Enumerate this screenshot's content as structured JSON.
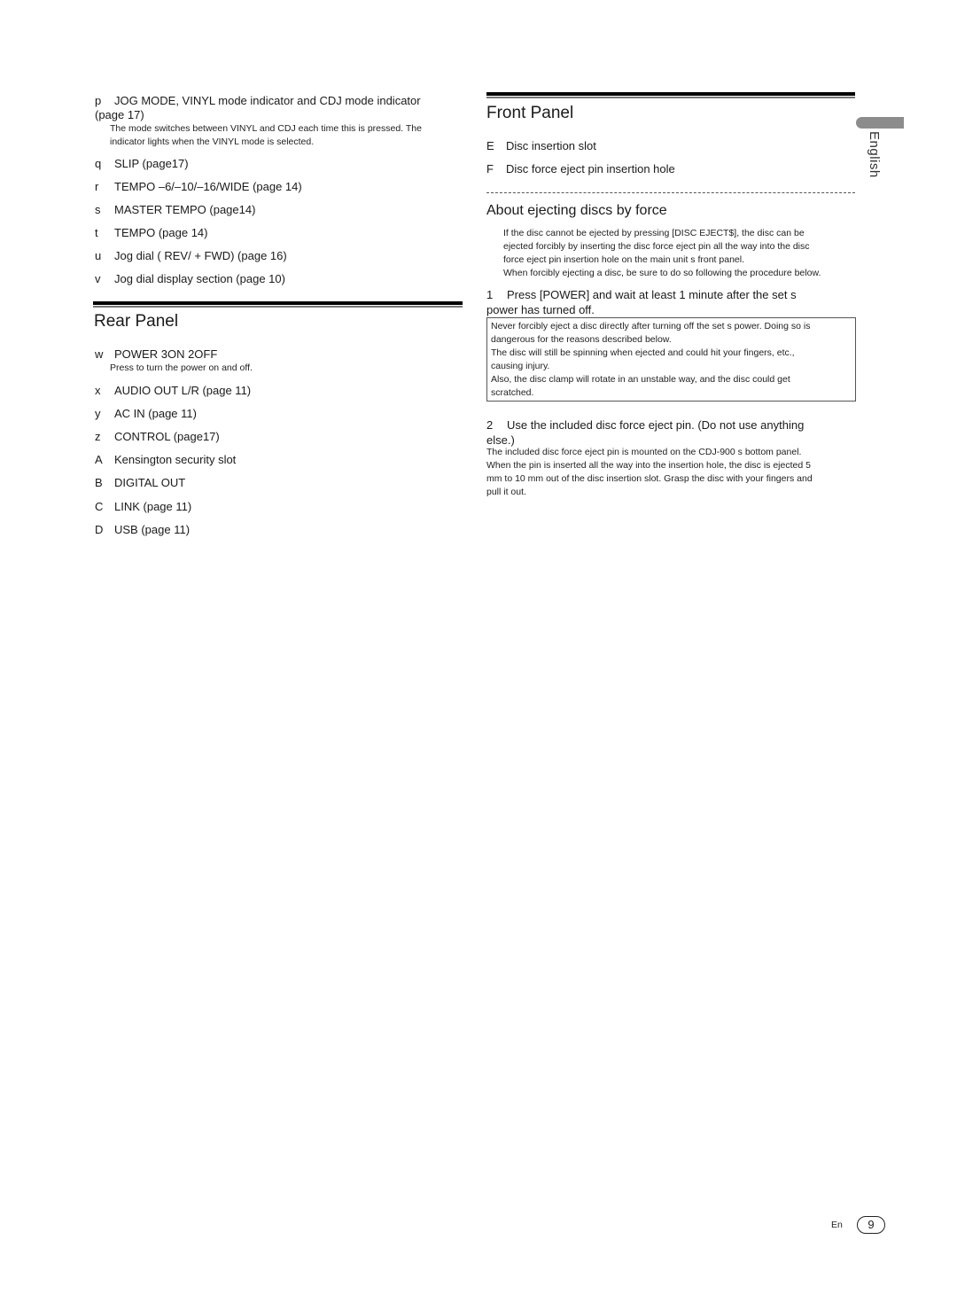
{
  "left_column": {
    "top_items": [
      {
        "marker": "p",
        "label": "JOG MODE, VINYL mode indicator and CDJ mode indicator",
        "label_cont": "(page 17)",
        "description": [
          "The mode switches between VINYL and CDJ each time this is pressed. The",
          "indicator lights when the VINYL mode is selected."
        ]
      },
      {
        "marker": "q",
        "label": "SLIP (page17)"
      },
      {
        "marker": "r",
        "label": "TEMPO –6/–10/–16/WIDE (page  14)"
      },
      {
        "marker": "s",
        "label": "MASTER TEMPO (page14)"
      },
      {
        "marker": "t",
        "label": "TEMPO (page 14)"
      },
      {
        "marker": "u",
        "label": "Jog dial (  REV/ + FWD) (page 16)"
      },
      {
        "marker": "v",
        "label": "Jog dial display section (page   10)"
      }
    ],
    "rear_panel": {
      "heading": "Rear Panel",
      "items": [
        {
          "marker": "w",
          "label": "POWER 3ON  2OFF",
          "description": "Press to turn the power on and off."
        },
        {
          "marker": "x",
          "label": "AUDIO OUT L/R (page 11)"
        },
        {
          "marker": "y",
          "label": "AC IN (page 11)"
        },
        {
          "marker": "z",
          "label": "CONTROL (page17)"
        },
        {
          "marker": "A",
          "label": "Kensington security slot"
        },
        {
          "marker": "B",
          "label": "DIGITAL OUT"
        },
        {
          "marker": "C",
          "label": "LINK (page 11)"
        },
        {
          "marker": "D",
          "label": "USB (page 11)"
        }
      ]
    }
  },
  "right_column": {
    "front_panel": {
      "heading": "Front Panel",
      "items": [
        {
          "marker": "E",
          "label": "Disc insertion slot"
        },
        {
          "marker": "F",
          "label": "Disc force eject pin insertion hole"
        }
      ]
    },
    "ejecting": {
      "heading": "About ejecting discs by force",
      "intro": [
        "If the disc cannot be ejected by pressing [DISC EJECT$], the disc can be",
        "ejected forcibly by inserting the disc force eject pin all the way into the disc",
        "force eject pin insertion hole on the main unit s front panel.",
        "When forcibly ejecting a disc, be sure to do so following the procedure below."
      ],
      "step1": {
        "number": "1",
        "text": "Press [POWER] and wait at least 1 minute after the set s",
        "text_cont": "power has turned off."
      },
      "warning": [
        "Never forcibly eject a disc directly after turning off the set s power. Doing so is",
        "dangerous for the reasons described below.",
        "The disc will still be spinning when ejected and could hit your fingers, etc.,",
        "causing injury.",
        "Also, the disc clamp will rotate in an unstable way, and the disc could get",
        "scratched."
      ],
      "step2": {
        "number": "2",
        "text": "Use the included disc force eject pin. (Do not use anything",
        "text_cont": "else.)"
      },
      "step2_body": [
        "The included disc force eject pin is mounted on the CDJ-900 s bottom panel.",
        "When the pin is inserted all the way into the insertion hole, the disc is ejected 5",
        "mm to 10 mm out of the disc insertion slot. Grasp the disc with your fingers and",
        "pull it out."
      ]
    }
  },
  "side_tab": {
    "label": "English"
  },
  "footer": {
    "lang": "En",
    "page_number": "9"
  }
}
